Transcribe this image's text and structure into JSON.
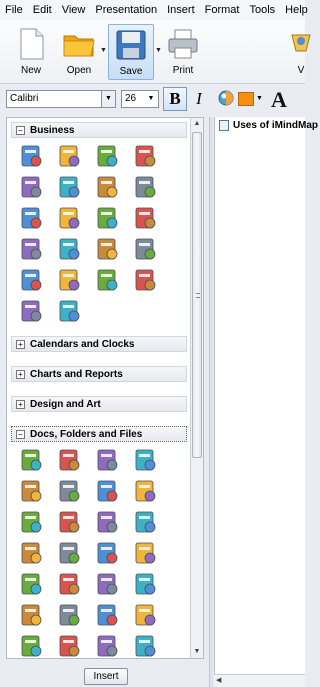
{
  "menu": [
    "File",
    "Edit",
    "View",
    "Presentation",
    "Insert",
    "Format",
    "Tools",
    "Help"
  ],
  "toolbar": {
    "new_label": "New",
    "open_label": "Open",
    "save_label": "Save",
    "print_label": "Print",
    "partial_label": "V"
  },
  "format": {
    "font": "Calibri",
    "size": "26",
    "bold": "B",
    "italic": "I",
    "big_a": "A",
    "fill_color": "#f5900f"
  },
  "categories": [
    {
      "label": "Business",
      "expanded": true
    },
    {
      "label": "Calendars and Clocks",
      "expanded": false
    },
    {
      "label": "Charts and Reports",
      "expanded": false
    },
    {
      "label": "Design and Art",
      "expanded": false
    },
    {
      "label": "Docs, Folders and Files",
      "expanded": true
    }
  ],
  "business_icons": [
    "cart-add",
    "bank",
    "briefcase",
    "coins",
    "credit-card",
    "credit-card-blue",
    "credit-card-gold",
    "cart-remove",
    "factory",
    "cabinet",
    "cabinet-blue",
    "handshake",
    "ledger",
    "receipt",
    "money",
    "office-building",
    "office-building-blue",
    "package",
    "package-tag",
    "package-arrow",
    "cart",
    "truck"
  ],
  "docs_icons": [
    "doc-add",
    "doc-stack-add",
    "folder-add",
    "doc-lens",
    "doc-blank",
    "folder-refresh",
    "doc-remove",
    "doc-stack-remove",
    "folder-remove",
    "folder-wrench",
    "doc-copy",
    "folder-arrow",
    "folder-open",
    "folder",
    "folder-open-2",
    "folders",
    "doc-list",
    "doc-image",
    "window",
    "doc-checklist",
    "doc-rotate",
    "doc-music",
    "doc-plain",
    "doc-text",
    "doc-numbered",
    "folder-brush",
    "doc-brush",
    "doc-pen",
    "doc-more",
    "doc-more-2",
    "doc-more-3",
    "doc-more-4"
  ],
  "insert_label": "Insert",
  "outline": {
    "title": "Uses of iMindMap"
  }
}
